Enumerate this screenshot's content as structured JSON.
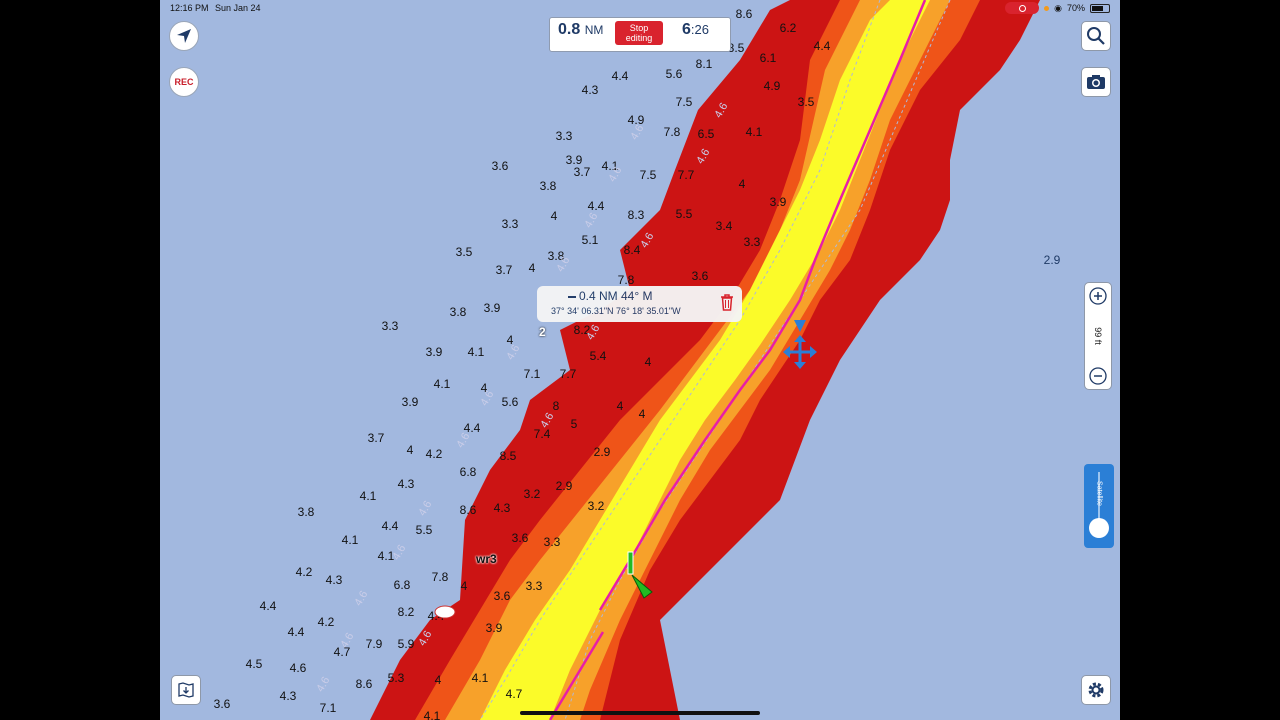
{
  "status_bar": {
    "time": "12:16 PM",
    "date": "Sun Jan 24",
    "battery": "70%"
  },
  "route_box": {
    "distance": "0.8",
    "distance_unit": "NM",
    "stop_label_1": "Stop",
    "stop_label_2": "editing",
    "time_h": "6",
    "time_m": ":26"
  },
  "rec_button": {
    "label": "REC"
  },
  "popup": {
    "bearing_line": "0.4 NM  44° M",
    "coords": "37° 34' 06.31\"N   76° 18' 35.01\"W"
  },
  "zoom": {
    "level": "99 ft"
  },
  "layer_toggle": {
    "label": "Satellite"
  },
  "waypoint": {
    "label": "wr3",
    "pin_number": "2"
  },
  "colors": {
    "water": "#a2b8df",
    "deep_red": "#cc1414",
    "orange": "#ef5418",
    "amber": "#f7a12a",
    "yellow": "#fbfb29",
    "route": "#e81ea6",
    "accent": "#2b7fd6"
  },
  "soundings": [
    [
      "8.6",
      744,
      14
    ],
    [
      "6.2",
      788,
      28
    ],
    [
      "4.4",
      822,
      46
    ],
    [
      "8.5",
      736,
      48
    ],
    [
      "6.1",
      768,
      58
    ],
    [
      "8.1",
      704,
      64
    ],
    [
      "4.4",
      620,
      76
    ],
    [
      "5.6",
      674,
      74
    ],
    [
      "4.9",
      772,
      86
    ],
    [
      "3.5",
      806,
      102
    ],
    [
      "4.3",
      590,
      90
    ],
    [
      "7.5",
      684,
      102
    ],
    [
      "4.9",
      636,
      120
    ],
    [
      "7.8",
      672,
      132
    ],
    [
      "6.5",
      706,
      134
    ],
    [
      "4.1",
      754,
      132
    ],
    [
      "3.3",
      564,
      136
    ],
    [
      "3.9",
      574,
      160
    ],
    [
      "3.6",
      500,
      166
    ],
    [
      "3.7",
      582,
      172
    ],
    [
      "4.1",
      610,
      166
    ],
    [
      "7.5",
      648,
      175
    ],
    [
      "7.7",
      686,
      175
    ],
    [
      "4",
      742,
      184
    ],
    [
      "3.8",
      548,
      186
    ],
    [
      "4.4",
      596,
      206
    ],
    [
      "3.9",
      778,
      202
    ],
    [
      "8.3",
      636,
      215
    ],
    [
      "5.5",
      684,
      214
    ],
    [
      "3.3",
      510,
      224
    ],
    [
      "4",
      554,
      216
    ],
    [
      "3.4",
      724,
      226
    ],
    [
      "5.1",
      590,
      240
    ],
    [
      "3.3",
      752,
      242
    ],
    [
      "3.5",
      464,
      252
    ],
    [
      "8.4",
      632,
      250
    ],
    [
      "3.8",
      556,
      256
    ],
    [
      "3.7",
      504,
      270
    ],
    [
      "4",
      532,
      268
    ],
    [
      "3.6",
      700,
      276
    ],
    [
      "7.8",
      626,
      280
    ],
    [
      "3.8",
      458,
      312
    ],
    [
      "3.9",
      492,
      308
    ],
    [
      "3.3",
      390,
      326
    ],
    [
      "4",
      510,
      340
    ],
    [
      "8.2",
      582,
      330
    ],
    [
      "3.9",
      434,
      352
    ],
    [
      "4.1",
      476,
      352
    ],
    [
      "5.4",
      598,
      356
    ],
    [
      "4",
      648,
      362
    ],
    [
      "7.1",
      532,
      374
    ],
    [
      "7.7",
      568,
      374
    ],
    [
      "4.1",
      442,
      384
    ],
    [
      "3.9",
      410,
      402
    ],
    [
      "4",
      484,
      388
    ],
    [
      "5.6",
      510,
      402
    ],
    [
      "8",
      556,
      406
    ],
    [
      "4",
      620,
      406
    ],
    [
      "4",
      642,
      414
    ],
    [
      "3.7",
      376,
      438
    ],
    [
      "4.4",
      472,
      428
    ],
    [
      "7.4",
      542,
      434
    ],
    [
      "5",
      574,
      424
    ],
    [
      "4",
      410,
      450
    ],
    [
      "4.2",
      434,
      454
    ],
    [
      "8.5",
      508,
      456
    ],
    [
      "2.9",
      602,
      452
    ],
    [
      "6.8",
      468,
      472
    ],
    [
      "4.3",
      406,
      484
    ],
    [
      "2.9",
      564,
      486
    ],
    [
      "4.1",
      368,
      496
    ],
    [
      "3.2",
      532,
      494
    ],
    [
      "3.2",
      596,
      506
    ],
    [
      "3.8",
      306,
      512
    ],
    [
      "8.6",
      468,
      510
    ],
    [
      "4.3",
      502,
      508
    ],
    [
      "4.4",
      390,
      526
    ],
    [
      "5.5",
      424,
      530
    ],
    [
      "3.6",
      520,
      538
    ],
    [
      "4.1",
      350,
      540
    ],
    [
      "3.3",
      552,
      542
    ],
    [
      "4.1",
      386,
      556
    ],
    [
      "4.2",
      304,
      572
    ],
    [
      "4.3",
      334,
      580
    ],
    [
      "7.8",
      440,
      577
    ],
    [
      "6.8",
      402,
      585
    ],
    [
      "4",
      464,
      586
    ],
    [
      "3.3",
      534,
      586
    ],
    [
      "4.4",
      268,
      606
    ],
    [
      "3.6",
      502,
      596
    ],
    [
      "8.2",
      406,
      612
    ],
    [
      "4.4",
      436,
      616
    ],
    [
      "4.2",
      326,
      622
    ],
    [
      "4.4",
      296,
      632
    ],
    [
      "3.9",
      494,
      628
    ],
    [
      "4.7",
      342,
      652
    ],
    [
      "7.9",
      374,
      644
    ],
    [
      "5.9",
      406,
      644
    ],
    [
      "4.5",
      254,
      664
    ],
    [
      "4.6",
      298,
      668
    ],
    [
      "5.3",
      396,
      678
    ],
    [
      "4",
      438,
      680
    ],
    [
      "4.1",
      480,
      678
    ],
    [
      "8.6",
      364,
      684
    ],
    [
      "4.3",
      288,
      696
    ],
    [
      "4.7",
      514,
      694
    ],
    [
      "3.6",
      222,
      704
    ],
    [
      "7.1",
      328,
      708
    ],
    [
      "4.1",
      432,
      716
    ],
    [
      "2.9",
      1052,
      260
    ]
  ],
  "contour_labels": [
    [
      "4.6",
      618,
      172
    ],
    [
      "4.6",
      640,
      130
    ],
    [
      "4.6",
      724,
      108
    ],
    [
      "4.6",
      706,
      154
    ],
    [
      "4.6",
      594,
      218
    ],
    [
      "4.6",
      566,
      262
    ],
    [
      "4.6",
      516,
      350
    ],
    [
      "4.6",
      490,
      396
    ],
    [
      "4.6",
      466,
      438
    ],
    [
      "4.6",
      428,
      506
    ],
    [
      "4.6",
      402,
      550
    ],
    [
      "4.6",
      364,
      596
    ],
    [
      "4.6",
      350,
      638
    ],
    [
      "4.6",
      326,
      682
    ],
    [
      "4.6",
      428,
      636
    ],
    [
      "4.6",
      550,
      418
    ],
    [
      "4.6",
      596,
      330
    ],
    [
      "4.6",
      650,
      238
    ]
  ]
}
